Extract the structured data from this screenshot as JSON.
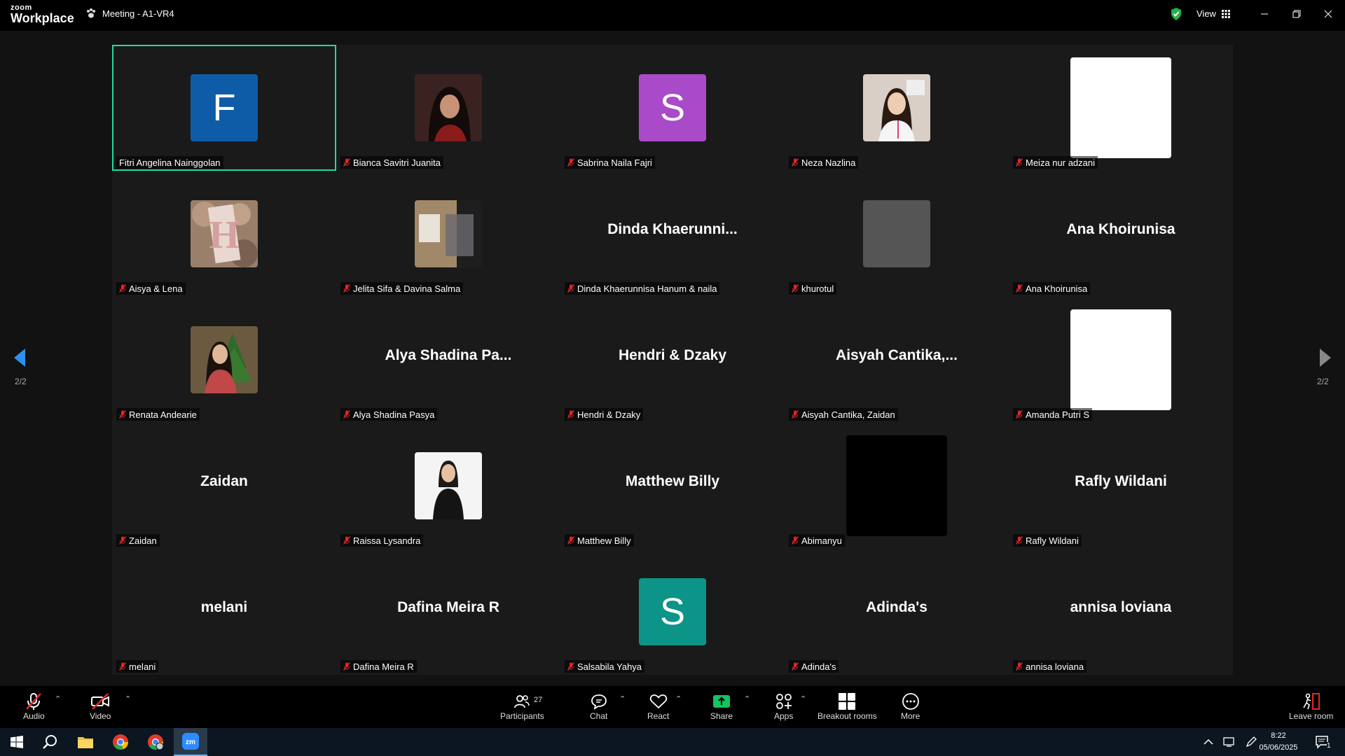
{
  "app": {
    "logo_top": "zoom",
    "logo_bottom": "Workplace",
    "meeting_title": "Meeting - A1-VR4",
    "view_label": "View"
  },
  "gallery": {
    "page_indicator": "2/2",
    "tiles": [
      {
        "name": "Fitri Angelina Nainggolan",
        "display": "letter",
        "letter": "F",
        "color": "#0e5ca8",
        "muted": false,
        "active": true
      },
      {
        "name": "Bianca Savitri Juanita",
        "display": "photo",
        "muted": true
      },
      {
        "name": "Sabrina Naila Fajri",
        "display": "letter",
        "letter": "S",
        "color": "#a94bc9",
        "muted": true
      },
      {
        "name": "Neza Nazlina",
        "display": "photo",
        "muted": true
      },
      {
        "name": "Meiza nur adzani",
        "display": "white",
        "muted": true
      },
      {
        "name": "Aisya & Lena",
        "display": "photo",
        "muted": true
      },
      {
        "name": "Jelita Sifa & Davina Salma",
        "display": "photo",
        "muted": true
      },
      {
        "name": "Dinda Khaerunnisa Hanum & naila",
        "display": "text",
        "big": "Dinda  Khaerunni...",
        "muted": true
      },
      {
        "name": "khurotul",
        "display": "gray",
        "muted": true
      },
      {
        "name": "Ana Khoirunisa",
        "display": "text",
        "big": "Ana Khoirunisa",
        "muted": true
      },
      {
        "name": "Renata Andearie",
        "display": "photo",
        "muted": true
      },
      {
        "name": "Alya Shadina Pasya",
        "display": "text",
        "big": "Alya  Shadina  Pa...",
        "muted": true
      },
      {
        "name": "Hendri & Dzaky",
        "display": "text",
        "big": "Hendri & Dzaky",
        "muted": true
      },
      {
        "name": "Aisyah Cantika, Zaidan",
        "display": "text",
        "big": "Aisyah  Cantika,...",
        "muted": true
      },
      {
        "name": "Amanda Putri S",
        "display": "white",
        "muted": true
      },
      {
        "name": "Zaidan",
        "display": "text",
        "big": "Zaidan",
        "muted": true
      },
      {
        "name": "Raissa Lysandra",
        "display": "photo",
        "muted": true
      },
      {
        "name": "Matthew Billy",
        "display": "text",
        "big": "Matthew Billy",
        "muted": true
      },
      {
        "name": "Abimanyu",
        "display": "black",
        "muted": true
      },
      {
        "name": "Rafly Wildani",
        "display": "text",
        "big": "Rafly Wildani",
        "muted": true
      },
      {
        "name": "melani",
        "display": "text",
        "big": "melani",
        "muted": true
      },
      {
        "name": "Dafina Meira R",
        "display": "text",
        "big": "Dafina Meira R",
        "muted": true
      },
      {
        "name": "Salsabila Yahya",
        "display": "letter",
        "letter": "S",
        "color": "#0d9488",
        "muted": true
      },
      {
        "name": "Adinda's",
        "display": "text",
        "big": "Adinda's",
        "muted": true
      },
      {
        "name": "annisa loviana",
        "display": "text",
        "big": "annisa loviana",
        "muted": true
      }
    ]
  },
  "toolbar": {
    "audio": "Audio",
    "video": "Video",
    "participants": "Participants",
    "participant_count": "27",
    "chat": "Chat",
    "react": "React",
    "share": "Share",
    "apps": "Apps",
    "breakout": "Breakout rooms",
    "more": "More",
    "leave": "Leave room"
  },
  "taskbar": {
    "time": "8:22",
    "date": "05/06/2025",
    "notification_count": "1"
  },
  "colors": {
    "accent_green": "#23d9a0",
    "share_green": "#14c45f",
    "mute_red": "#e02828",
    "shield_green": "#22b14c"
  }
}
